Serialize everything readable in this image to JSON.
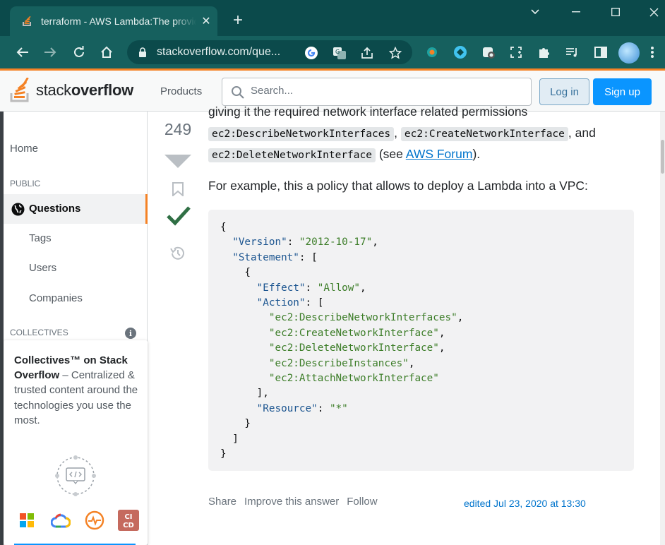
{
  "browser": {
    "tab_title": "terraform - AWS Lambda:The provided execution role does not have permissions",
    "tab_close": "✕",
    "new_tab": "+",
    "url": "stackoverflow.com/que...",
    "window_controls": {
      "minimize": "—",
      "maximize": "☐",
      "close": "✕",
      "dropdown": "⌄"
    }
  },
  "so_header": {
    "logo_text_a": "stack",
    "logo_text_b": "overflow",
    "products": "Products",
    "search_placeholder": "Search...",
    "login": "Log in",
    "signup": "Sign up"
  },
  "sidebar": {
    "home": "Home",
    "public": "PUBLIC",
    "questions": "Questions",
    "tags": "Tags",
    "users": "Users",
    "companies": "Companies",
    "collectives": "COLLECTIVES",
    "info": "i",
    "collectives_title": "Collectives™ on Stack Overflow",
    "collectives_desc": " – Centralized & trusted content around the technologies you use the most."
  },
  "vote": {
    "count": "249"
  },
  "answer": {
    "clipped_line": "giving it the required network interface related permissions",
    "code1": "ec2:DescribeNetworkInterfaces",
    "sep1": ",",
    "code2": "ec2:CreateNetworkInterface",
    "and": ", and",
    "code3": "ec2:DeleteNetworkInterface",
    "see_open": " (see ",
    "link": "AWS Forum",
    "see_close": ").",
    "example": "For example, this a policy that allows to deploy a Lambda into a VPC:",
    "json": {
      "version_key": "\"Version\"",
      "version_val": "\"2012-10-17\"",
      "statement_key": "\"Statement\"",
      "effect_key": "\"Effect\"",
      "effect_val": "\"Allow\"",
      "action_key": "\"Action\"",
      "actions": [
        "\"ec2:DescribeNetworkInterfaces\"",
        "\"ec2:CreateNetworkInterface\"",
        "\"ec2:DeleteNetworkInterface\"",
        "\"ec2:DescribeInstances\"",
        "\"ec2:AttachNetworkInterface\""
      ],
      "resource_key": "\"Resource\"",
      "resource_val": "\"*\""
    }
  },
  "post_menu": {
    "share": "Share",
    "improve": "Improve this answer",
    "follow": "Follow"
  },
  "edited": "edited Jul 23, 2020 at 13:30",
  "colors": {
    "brand_orange": "#f48225",
    "accepted_green": "#2f6f44",
    "link_blue": "#0074cc",
    "chrome_teal": "#0b4a4b"
  }
}
